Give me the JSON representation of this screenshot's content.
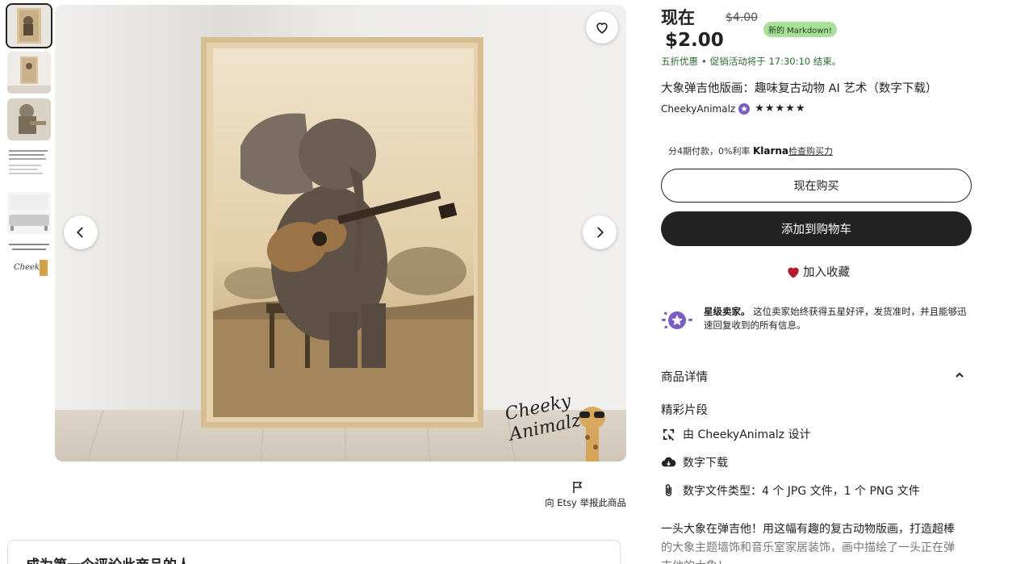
{
  "gallery": {
    "thumbnails": [
      "thumb-1",
      "thumb-2",
      "thumb-3",
      "thumb-4",
      "thumb-5",
      "thumb-6"
    ],
    "active_index": 0,
    "brand_mark_line1": "Cheeky",
    "brand_mark_line2": "Animalz"
  },
  "report": {
    "label": "向 Etsy 举报此商品"
  },
  "reviews": {
    "title": "成为第一个评论此商品的人"
  },
  "listing": {
    "price_prefix": "现在",
    "price_original": "$4.00",
    "markdown_badge": "新的 Markdown!",
    "price_current": "$2.00",
    "promo_discount": "五折优惠",
    "promo_dot": "•",
    "promo_timer": "促销活动将于 17:30:10 结束。",
    "title": "大象弹吉他版画：趣味复古动物 AI 艺术（数字下载）",
    "seller_name": "CheekyAnimalz",
    "rating_stars": "★★★★★",
    "rating": 5,
    "klarna_text": "分4期付款，0%利率",
    "klarna_logo": "Klarna",
    "klarna_link": "检查购买力",
    "buy_now": "现在购买",
    "add_to_cart": "添加到购物车",
    "add_to_favorites": "加入收藏",
    "star_seller_title": "星级卖家。",
    "star_seller_text": "这位卖家始终获得五星好评，发货准时，并且能够迅速回复收到的所有信息。",
    "details_header": "商品详情",
    "highlights_title": "精彩片段",
    "highlight_designed_by": "由 CheekyAnimalz 设计",
    "highlight_download": "数字下载",
    "highlight_filetypes": "数字文件类型：4 个 JPG 文件，1 个 PNG 文件",
    "description_1": "一头大象在弹吉他！用这幅有趣的复古动物版画，打造超棒",
    "description_2": "的大象主题墙饰和音乐室家居装饰，画中描绘了一头正在弹",
    "description_3": "吉他的大象！"
  },
  "colors": {
    "accent_dark": "#222222",
    "badge_green": "#a8e09a",
    "promo_green": "#2e6b2e",
    "heart_red": "#b01c2e",
    "star_purple": "#7a5cc2"
  }
}
